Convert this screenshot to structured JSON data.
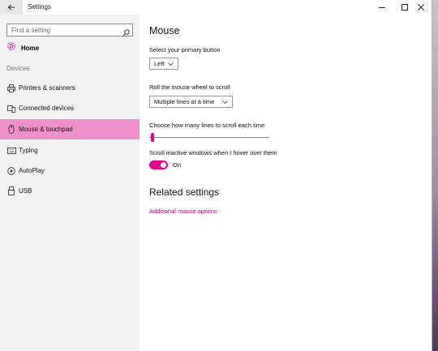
{
  "window": {
    "title": "Settings",
    "controls": {
      "minimize": "minimize",
      "maximize": "maximize",
      "close": "close"
    }
  },
  "sidebar": {
    "search": {
      "placeholder": "Find a setting",
      "value": ""
    },
    "home_label": "Home",
    "section_label": "Devices",
    "items": [
      {
        "label": "Printers & scanners",
        "icon": "printer-icon",
        "active": false
      },
      {
        "label": "Connected devices",
        "icon": "connected-devices-icon",
        "active": false
      },
      {
        "label": "Mouse & touchpad",
        "icon": "mouse-icon",
        "active": true
      },
      {
        "label": "Typing",
        "icon": "keyboard-icon",
        "active": false
      },
      {
        "label": "AutoPlay",
        "icon": "autoplay-icon",
        "active": false
      },
      {
        "label": "USB",
        "icon": "usb-icon",
        "active": false
      }
    ]
  },
  "main": {
    "title": "Mouse",
    "primary_button": {
      "label": "Select your primary button",
      "value": "Left"
    },
    "scroll_wheel": {
      "label": "Roll the mouse wheel to scroll",
      "value": "Multiple lines at a time"
    },
    "lines_slider": {
      "label": "Choose how many lines to scroll each time",
      "level_fraction": 0.02
    },
    "inactive_scroll": {
      "label": "Scroll inactive windows when I hover over them",
      "state": "On"
    },
    "related_title": "Related settings",
    "related_link": "Additional mouse options"
  },
  "colors": {
    "accent": "#e3008c",
    "active_nav": "#ef8fcc",
    "link": "#c3007a"
  }
}
